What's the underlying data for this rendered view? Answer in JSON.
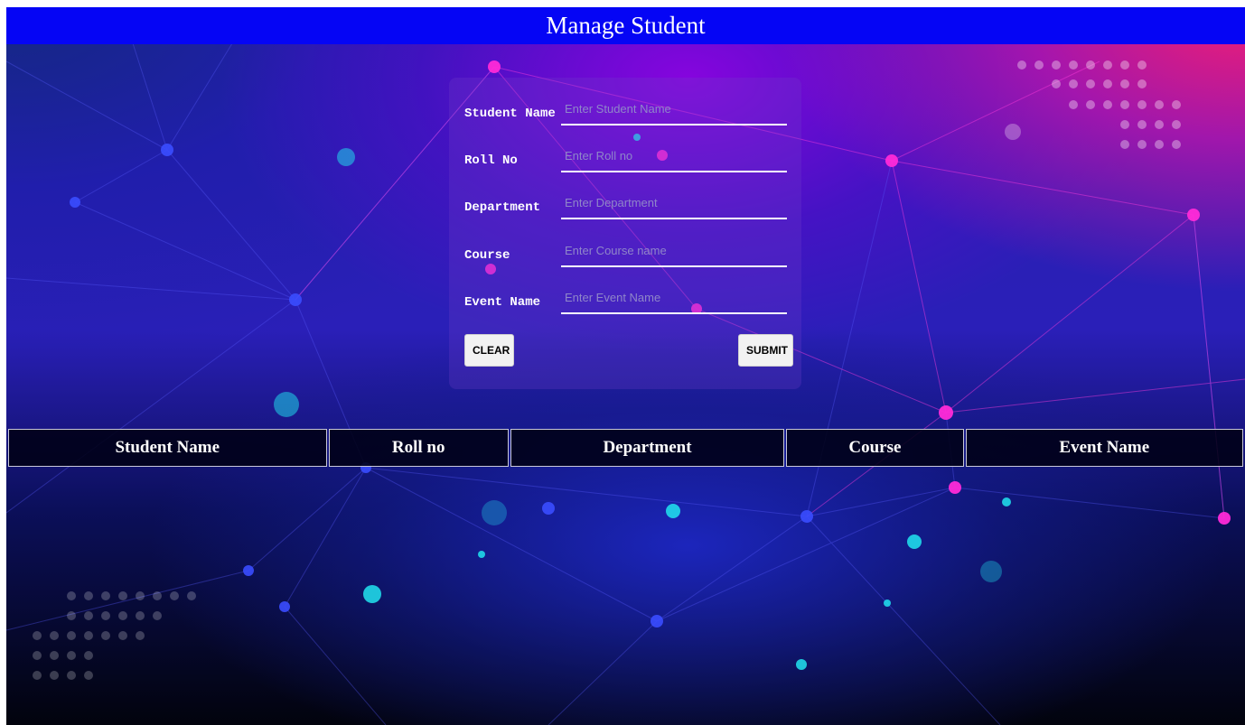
{
  "header": {
    "title": "Manage Student"
  },
  "form": {
    "fields": [
      {
        "label": "Student Name",
        "value": "",
        "placeholder": "Enter Student Name"
      },
      {
        "label": "Roll No",
        "value": "",
        "placeholder": "Enter Roll no"
      },
      {
        "label": "Department",
        "value": "",
        "placeholder": "Enter Department"
      },
      {
        "label": "Course",
        "value": "",
        "placeholder": "Enter Course name"
      },
      {
        "label": "Event Name",
        "value": "",
        "placeholder": "Enter Event Name"
      }
    ],
    "clear_label": "CLEAR",
    "submit_label": "SUBMIT"
  },
  "table": {
    "columns": [
      "Student Name",
      "Roll no",
      "Department",
      "Course",
      "Event Name"
    ],
    "rows": []
  },
  "colors": {
    "header_bg": "#0505f5",
    "accent_pink": "#ff2ad8",
    "accent_blue": "#3a4cff",
    "accent_cyan": "#22e6f0"
  }
}
